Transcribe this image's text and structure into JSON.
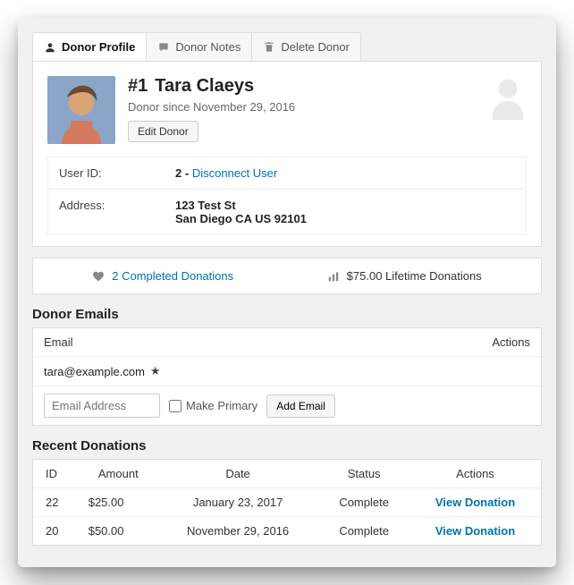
{
  "tabs": {
    "profile": "Donor Profile",
    "notes": "Donor Notes",
    "delete": "Delete Donor"
  },
  "profile": {
    "id_prefix": "#1",
    "name": "Tara Claeys",
    "since": "Donor since November 29, 2016",
    "edit_label": "Edit Donor"
  },
  "info": {
    "user_id_label": "User ID:",
    "user_id": "2",
    "disconnect": "Disconnect User",
    "address_label": "Address:",
    "address_line1": "123 Test St",
    "address_line2": "San Diego CA US 92101"
  },
  "stats": {
    "completed": "2 Completed Donations",
    "lifetime": "$75.00 Lifetime Donations"
  },
  "emails_section": {
    "heading": "Donor Emails",
    "col_email": "Email",
    "col_actions": "Actions",
    "email0": "tara@example.com",
    "placeholder": "Email Address",
    "make_primary": "Make Primary",
    "add_label": "Add Email"
  },
  "donations_section": {
    "heading": "Recent Donations",
    "cols": {
      "id": "ID",
      "amount": "Amount",
      "date": "Date",
      "status": "Status",
      "actions": "Actions"
    },
    "rows": [
      {
        "id": "22",
        "amount": "$25.00",
        "date": "January 23, 2017",
        "status": "Complete",
        "action": "View Donation"
      },
      {
        "id": "20",
        "amount": "$50.00",
        "date": "November 29, 2016",
        "status": "Complete",
        "action": "View Donation"
      }
    ]
  }
}
